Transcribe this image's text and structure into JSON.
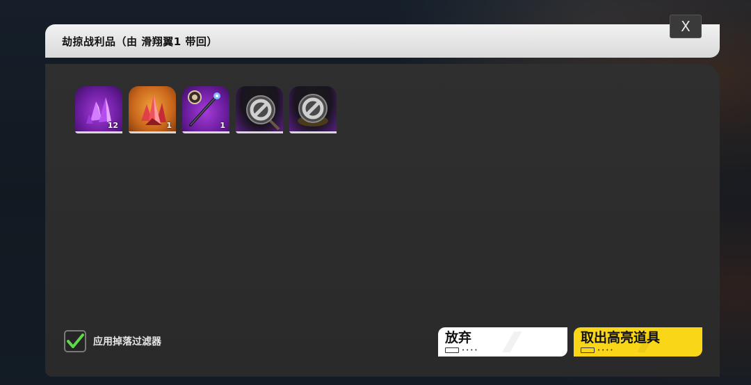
{
  "dialog": {
    "title": "劫掠战利品（由 滑翔翼1 带回）",
    "close_label": "X"
  },
  "items": [
    {
      "icon": "purple-crystal-icon",
      "rarity": "purple",
      "count": "12"
    },
    {
      "icon": "red-crystal-icon",
      "rarity": "orange",
      "count": "1"
    },
    {
      "icon": "staff-weapon-icon",
      "rarity": "purple",
      "count": "1"
    },
    {
      "icon": "blocked-magnifier-icon",
      "rarity": "dark",
      "count": ""
    },
    {
      "icon": "blocked-item-icon",
      "rarity": "dark",
      "count": ""
    }
  ],
  "filter": {
    "label": "应用掉落过滤器",
    "checked": true,
    "check_color": "#5fd84a"
  },
  "buttons": {
    "abandon_label": "放弃",
    "take_label": "取出高亮道具",
    "take_color": "#f9d718"
  }
}
